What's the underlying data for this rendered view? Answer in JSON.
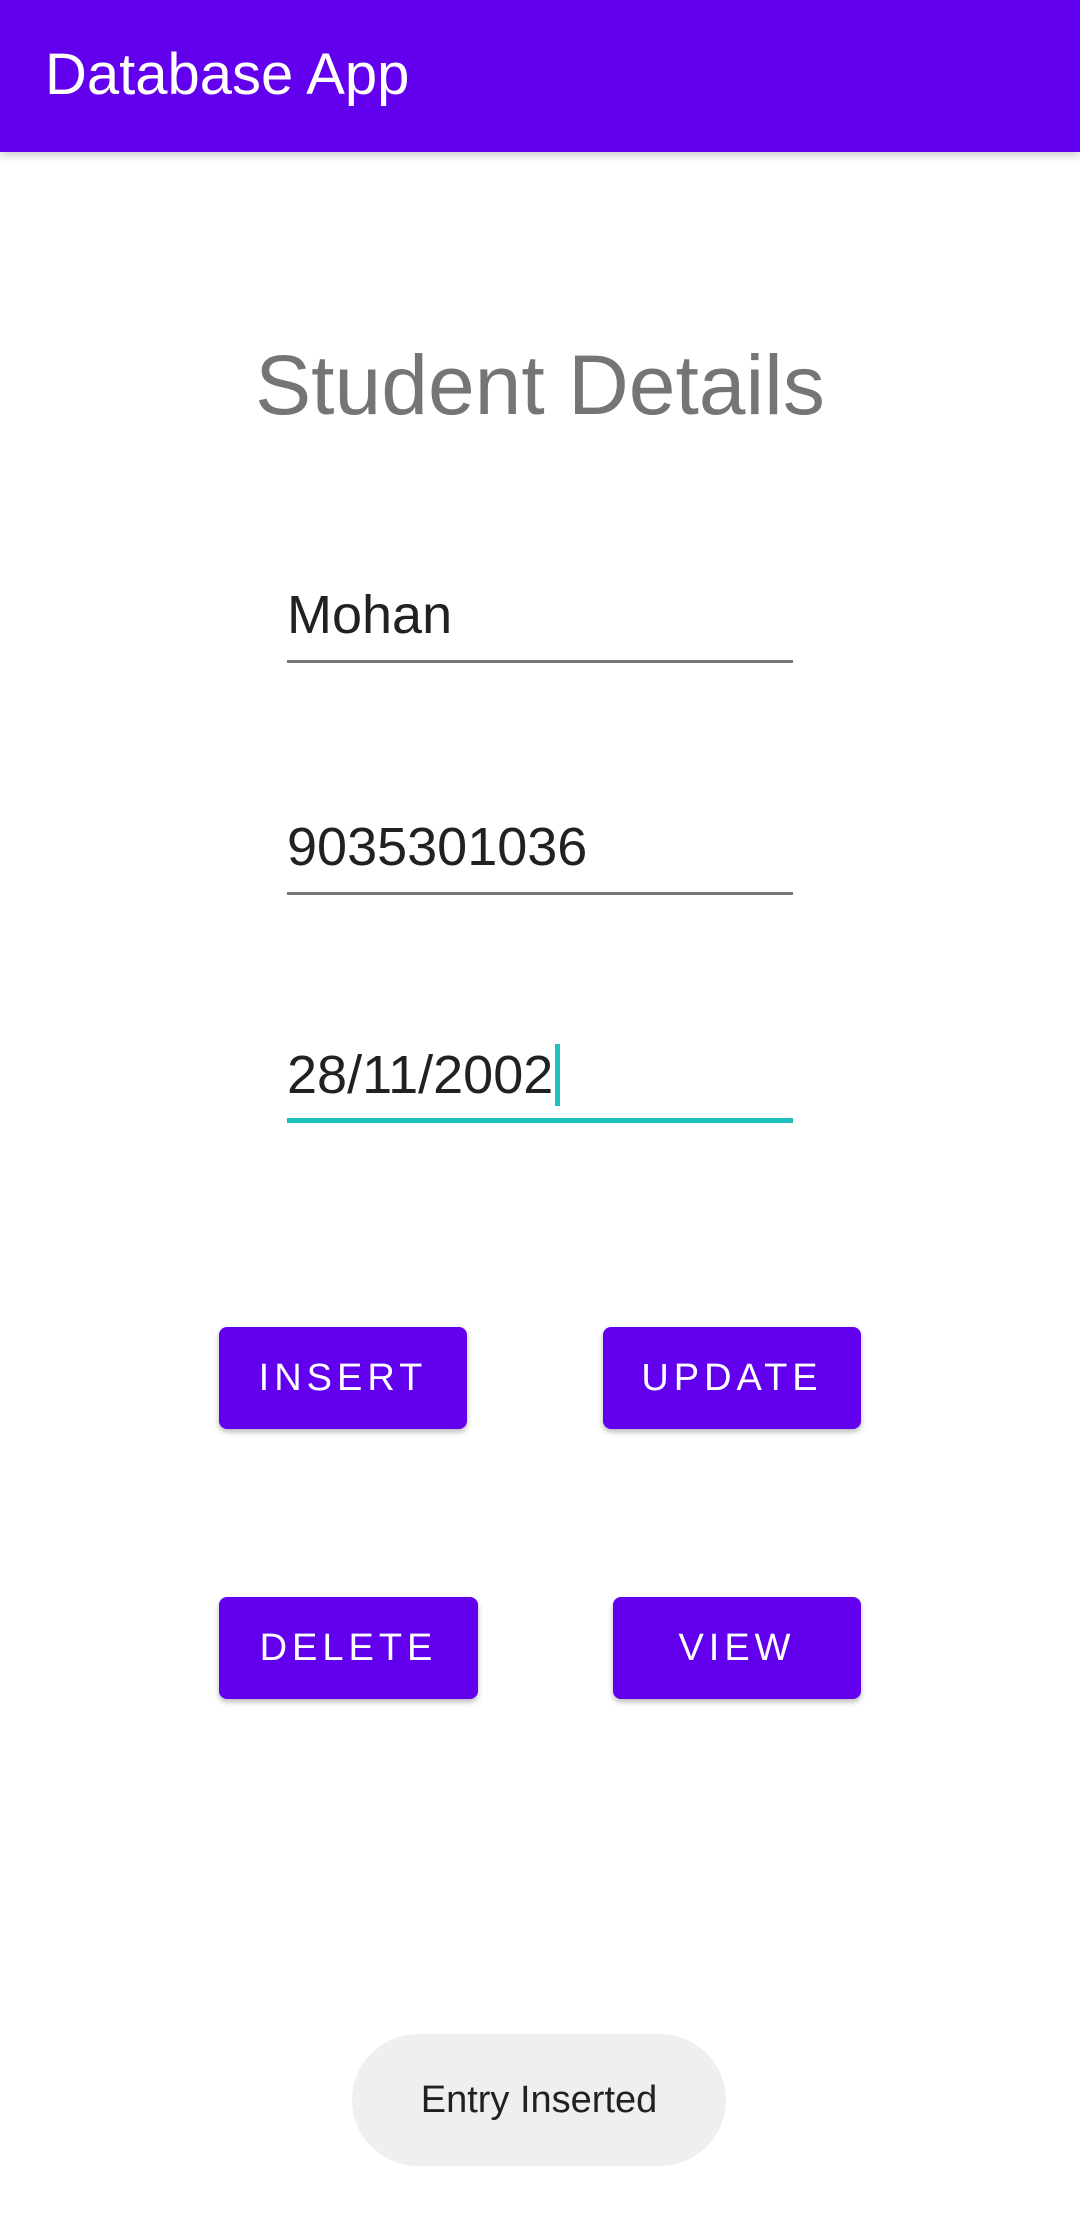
{
  "app_bar": {
    "title": "Database App"
  },
  "form": {
    "title": "Student Details",
    "fields": [
      {
        "value": "Mohan"
      },
      {
        "value": "9035301036"
      },
      {
        "value": "28/11/2002",
        "focused": true
      }
    ]
  },
  "buttons": {
    "insert": "INSERT",
    "update": "UPDATE",
    "delete": "DELETE",
    "view": "VIEW"
  },
  "toast": {
    "message": "Entry Inserted"
  },
  "colors": {
    "primary": "#6200EE",
    "accent": "#1EC1BC",
    "title_text": "#757575",
    "toast_bg": "#EFEFEF"
  }
}
